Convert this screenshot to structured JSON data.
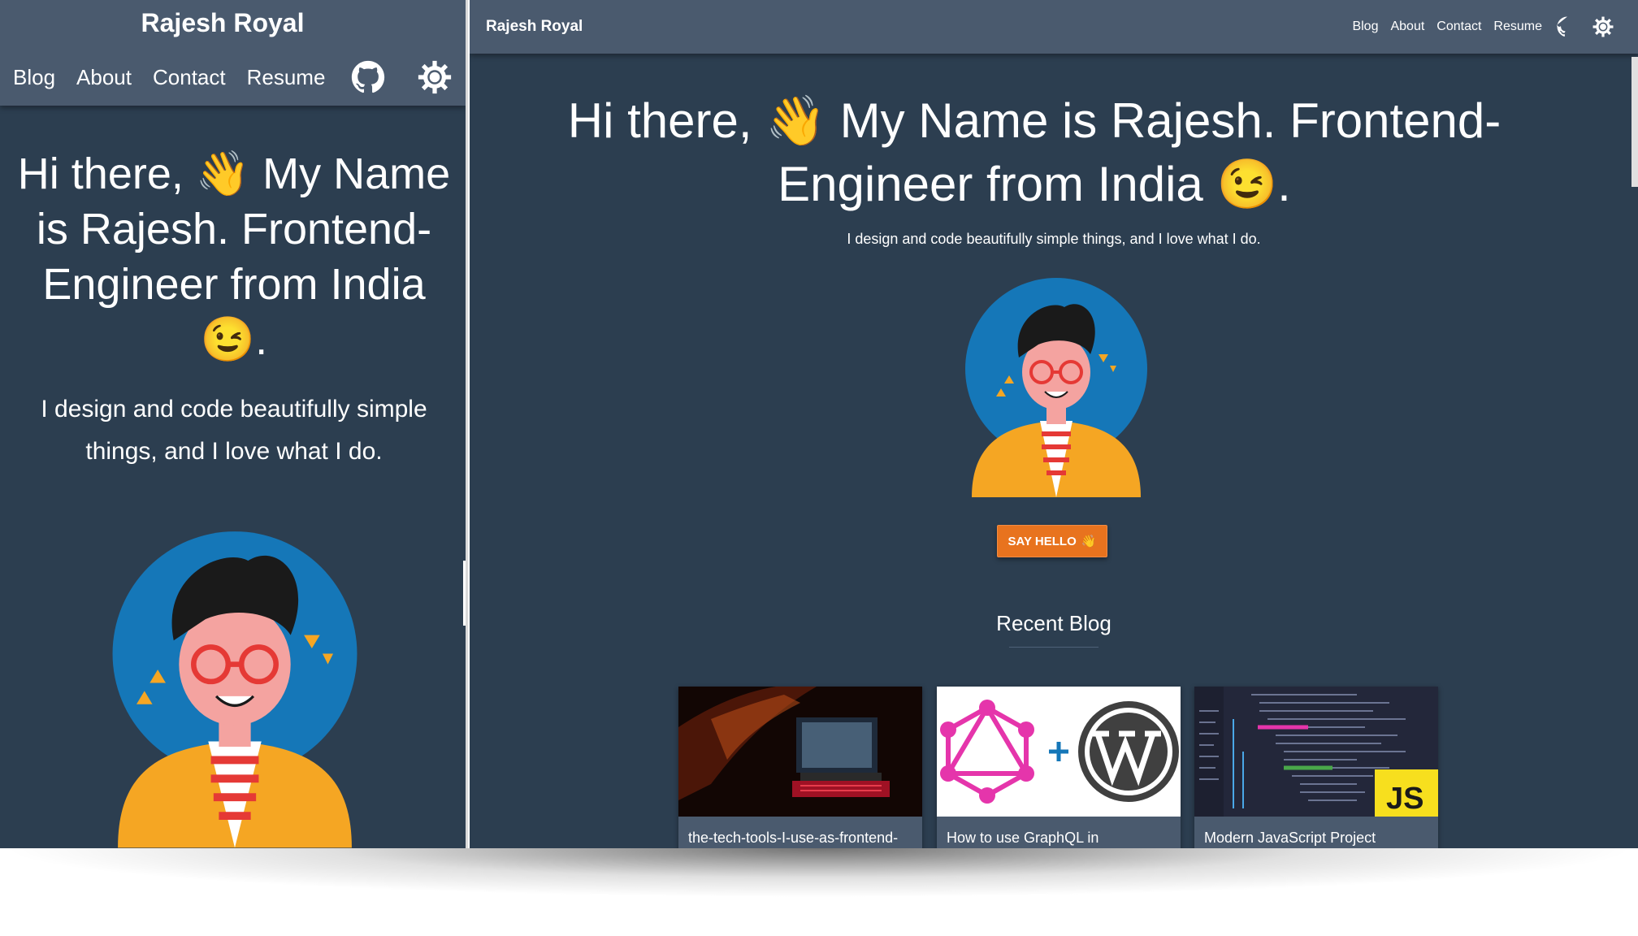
{
  "brand": "Rajesh Royal",
  "nav": {
    "blog": "Blog",
    "about": "About",
    "contact": "Contact",
    "resume": "Resume"
  },
  "icons": {
    "github": "github-icon",
    "theme": "sun-gear-icon"
  },
  "hero": {
    "line_a": "Hi there, ",
    "line_b": " My Name is Rajesh. Frontend-Engineer from India ",
    "wave": "👋",
    "wink": "😉",
    "end": ".",
    "sub": "I design and code beautifully simple things, and I love what I do."
  },
  "cta": {
    "label": "SAY HELLO"
  },
  "recent": {
    "title": "Recent Blog",
    "cards": [
      {
        "title": "the-tech-tools-I-use-as-frontend-"
      },
      {
        "title": "How to use GraphQL in"
      },
      {
        "title": "Modern JavaScript Project"
      }
    ]
  },
  "colors": {
    "bg": "#2c3e50",
    "nav": "#4a5a6e",
    "accent": "#e8731e",
    "avatar_circle": "#1577b8",
    "jacket": "#f5a623"
  }
}
